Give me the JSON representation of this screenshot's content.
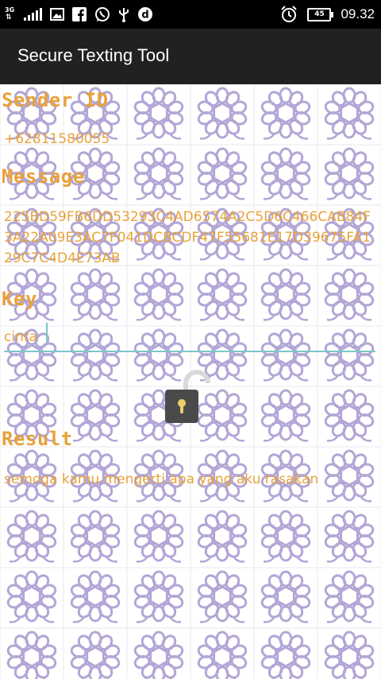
{
  "status_bar": {
    "network": "3G",
    "battery": "45",
    "time": "09.32",
    "icons": [
      "signal-icon",
      "image-icon",
      "facebook-icon",
      "whatsapp-icon",
      "usb-icon",
      "dictionary-icon",
      "alarm-icon",
      "battery-icon"
    ]
  },
  "app_bar": {
    "title": "Secure Texting Tool"
  },
  "form": {
    "sender_label": "Sender ID",
    "sender_value": "+62811580055",
    "message_label": "Message",
    "message_value": "225BD59FB6DD53293C4AD6574A2C5D6C466CAB84F3A22A09E3AC7F041DCBCDF47F55681E17D39675FA129C7C4D4E73AB",
    "key_label": "Key",
    "key_value": "cinta",
    "lock_button": "lock-open-icon",
    "result_label": "Result",
    "result_value": "semoga kamu mengerti apa yang aku rasakan"
  },
  "colors": {
    "text_accent": "#e8a23a",
    "input_underline": "#7ac7c7",
    "pattern": "#b3a6d6",
    "app_bar": "#212121",
    "status_bar": "#000000"
  }
}
